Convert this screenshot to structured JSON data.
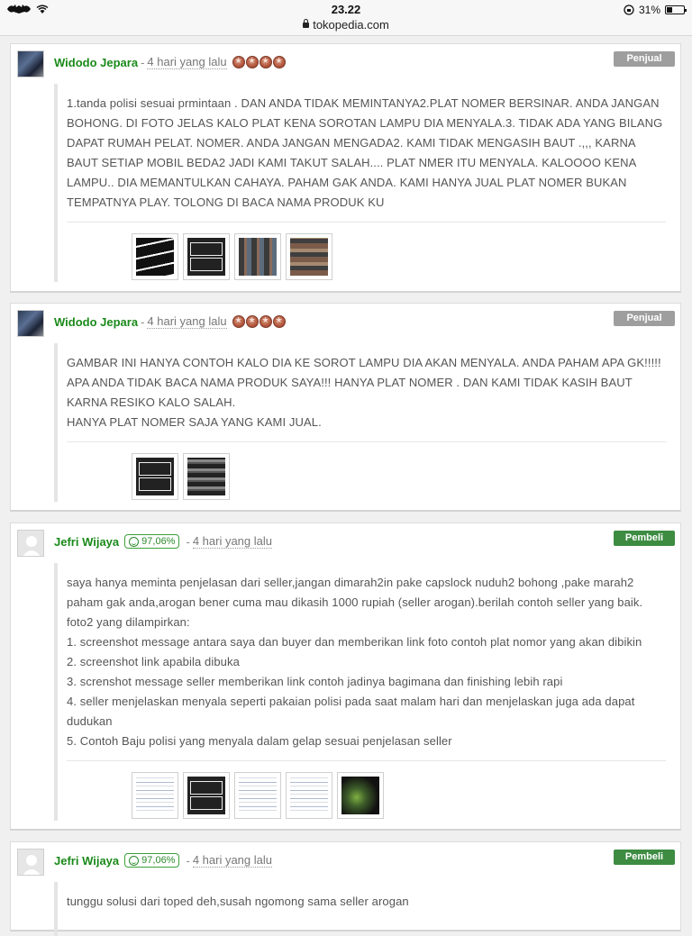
{
  "statusbar": {
    "time": "23.22",
    "url": "tokopedia.com",
    "battery": "31%",
    "battery_level": 0.31
  },
  "reviews": [
    {
      "user": "Widodo Jepara",
      "sep": "-",
      "time": "4 hari yang lalu",
      "role": "Penjual",
      "role_type": "seller",
      "avatar": "photo",
      "medals": 4,
      "reputation": null,
      "lines": [
        "1.tanda polisi sesuai prmintaan . DAN ANDA TIDAK MEMINTANYA2.PLAT NOMER BERSINAR. ANDA JANGAN BOHONG. DI FOTO JELAS KALO PLAT KENA SOROTAN LAMPU DIA MENYALA.3. TIDAK ADA YANG BILANG DAPAT RUMAH PELAT. NOMER. ANDA JANGAN MENGADA2. KAMI TIDAK MENGASIH BAUT .,,, KARNA BAUT SETIAP MOBIL BEDA2 JADI KAMI TAKUT SALAH.... PLAT NMER ITU MENYALA. KALOOOO KENA LAMPU.. DIA MEMANTULKAN CAHAYA. PAHAM GAK ANDA. KAMI HANYA JUAL PLAT NOMER BUKAN TEMPATNYA PLAY. TOLONG DI BACA NAMA PRODUK KU"
      ],
      "attachments": [
        "plates3",
        "plate",
        "grid1",
        "grid2"
      ]
    },
    {
      "user": "Widodo Jepara",
      "sep": "-",
      "time": "4 hari yang lalu",
      "role": "Penjual",
      "role_type": "seller",
      "avatar": "photo",
      "medals": 4,
      "reputation": null,
      "lines": [
        "GAMBAR INI HANYA CONTOH KALO DIA KE SOROT LAMPU DIA AKAN MENYALA. ANDA PAHAM APA GK!!!!! APA ANDA TIDAK BACA NAMA PRODUK SAYA!!! HANYA PLAT NOMER . DAN KAMI TIDAK KASIH BAUT KARNA RESIKO KALO SALAH.",
        "HANYA PLAT NOMER SAJA YANG KAMI JUAL."
      ],
      "attachments": [
        "plate",
        "grid3"
      ]
    },
    {
      "user": "Jefri Wijaya",
      "sep": "-",
      "time": "4 hari yang lalu",
      "role": "Pembeli",
      "role_type": "buyer",
      "avatar": "blank",
      "medals": 0,
      "reputation": "97,06%",
      "lines": [
        "saya hanya meminta penjelasan dari seller,jangan dimarah2in pake capslock nuduh2 bohong ,pake marah2 paham gak anda,arogan bener cuma mau dikasih 1000 rupiah (seller arogan).berilah contoh seller yang baik.",
        "foto2 yang dilampirkan:",
        "1. screenshot message antara saya dan buyer dan memberikan link foto contoh plat nomor yang akan dibikin",
        "2. screenshot link apabila dibuka",
        "3. screnshot message seller memberikan link contoh jadinya bagimana dan finishing lebih rapi",
        "4. seller menjelaskan menyala seperti pakaian polisi pada saat malam hari dan menjelaskan juga ada dapat dudukan",
        "5. Contoh Baju polisi yang menyala dalam gelap sesuai penjelasan seller"
      ],
      "attachments": [
        "shot",
        "plate",
        "shot",
        "shot",
        "dark"
      ]
    },
    {
      "user": "Jefri Wijaya",
      "sep": "-",
      "time": "4 hari yang lalu",
      "role": "Pembeli",
      "role_type": "buyer",
      "avatar": "blank",
      "medals": 0,
      "reputation": "97,06%",
      "lines": [
        "tunggu solusi dari toped deh,susah ngomong sama seller arogan"
      ],
      "attachments": []
    }
  ]
}
